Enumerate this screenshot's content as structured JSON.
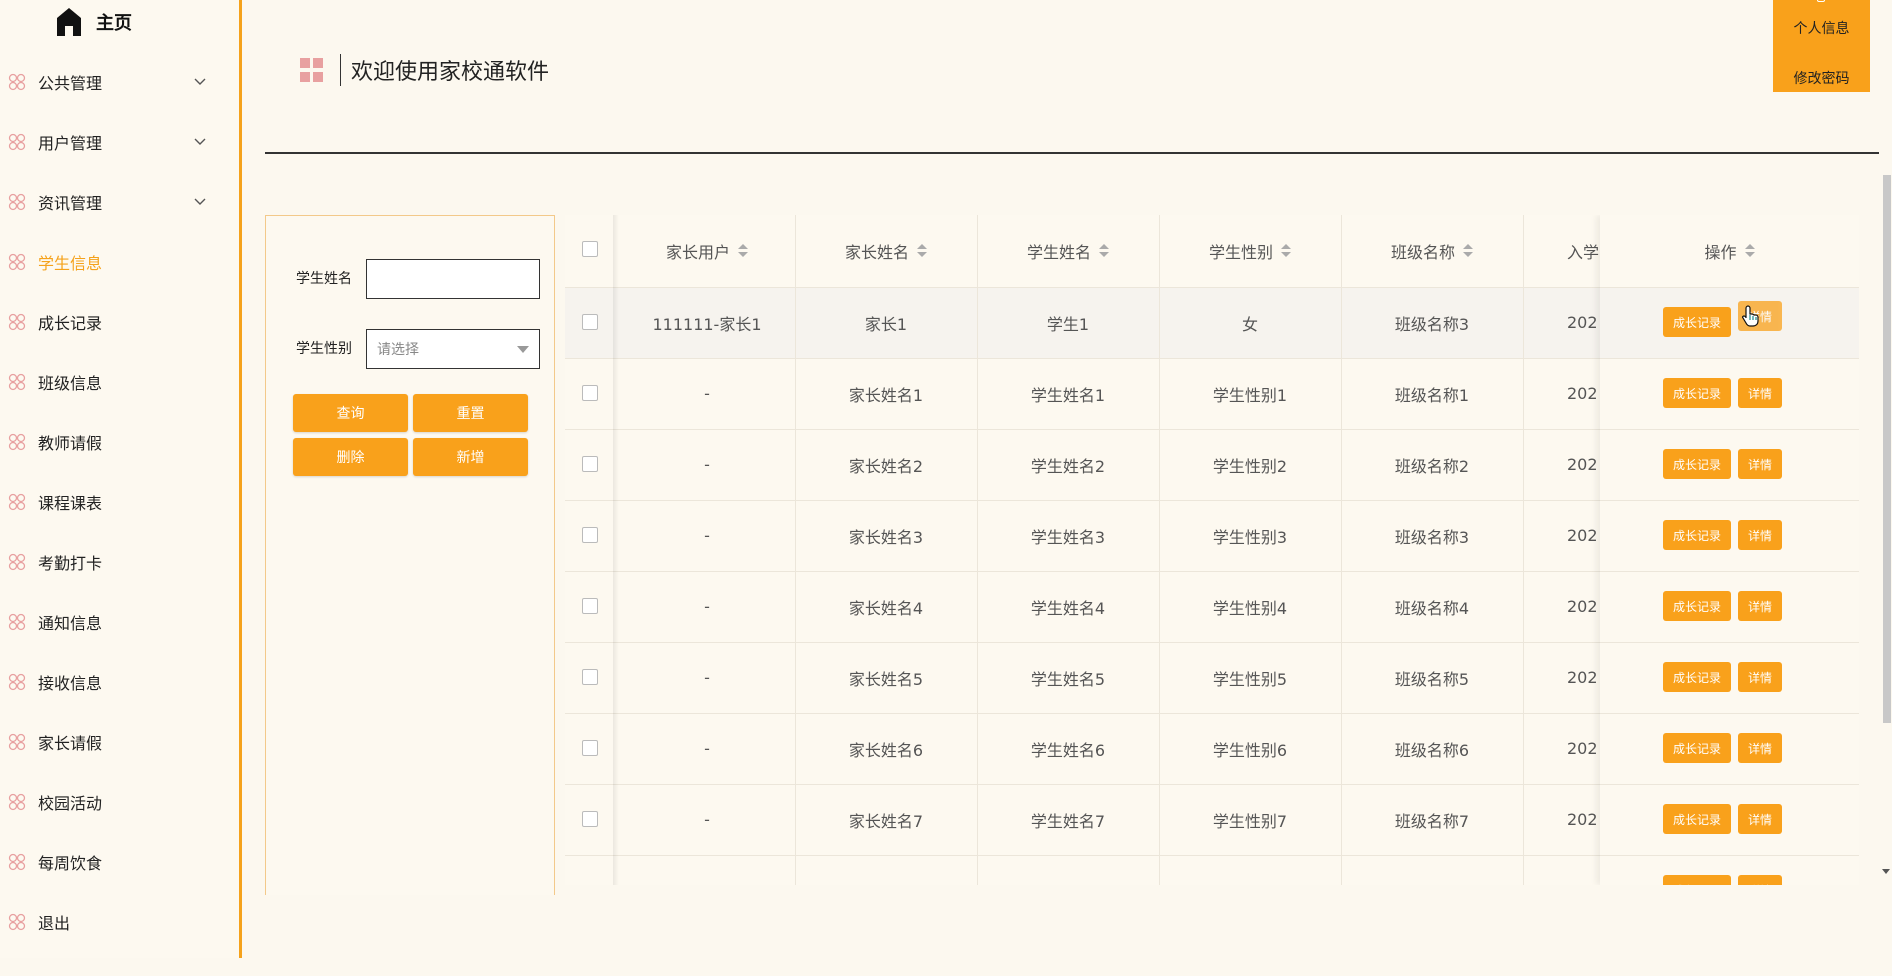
{
  "sidebar": {
    "home_label": "主页",
    "items": [
      {
        "label": "公共管理",
        "has_children": true,
        "active": false
      },
      {
        "label": "用户管理",
        "has_children": true,
        "active": false
      },
      {
        "label": "资讯管理",
        "has_children": true,
        "active": false
      },
      {
        "label": "学生信息",
        "has_children": false,
        "active": true
      },
      {
        "label": "成长记录",
        "has_children": false,
        "active": false
      },
      {
        "label": "班级信息",
        "has_children": false,
        "active": false
      },
      {
        "label": "教师请假",
        "has_children": false,
        "active": false
      },
      {
        "label": "课程课表",
        "has_children": false,
        "active": false
      },
      {
        "label": "考勤打卡",
        "has_children": false,
        "active": false
      },
      {
        "label": "通知信息",
        "has_children": false,
        "active": false
      },
      {
        "label": "接收信息",
        "has_children": false,
        "active": false
      },
      {
        "label": "家长请假",
        "has_children": false,
        "active": false
      },
      {
        "label": "校园活动",
        "has_children": false,
        "active": false
      },
      {
        "label": "每周饮食",
        "has_children": false,
        "active": false
      },
      {
        "label": "退出",
        "has_children": false,
        "active": false
      }
    ]
  },
  "user_menu": {
    "profile_label": "个人信息",
    "password_label": "修改密码"
  },
  "header": {
    "title": "欢迎使用家校通软件"
  },
  "search": {
    "name_label": "学生姓名",
    "name_value": "",
    "gender_label": "学生性别",
    "gender_placeholder": "请选择",
    "query_label": "查询",
    "reset_label": "重置",
    "delete_label": "删除",
    "add_label": "新增"
  },
  "table": {
    "columns": [
      "家长用户",
      "家长姓名",
      "学生姓名",
      "学生性别",
      "班级名称",
      "入学"
    ],
    "op_header": "操作",
    "rows": [
      {
        "cells": [
          "111111-家长1",
          "家长1",
          "学生1",
          "女",
          "班级名称3",
          "202"
        ]
      },
      {
        "cells": [
          "-",
          "家长姓名1",
          "学生姓名1",
          "学生性别1",
          "班级名称1",
          "202"
        ]
      },
      {
        "cells": [
          "-",
          "家长姓名2",
          "学生姓名2",
          "学生性别2",
          "班级名称2",
          "202"
        ]
      },
      {
        "cells": [
          "-",
          "家长姓名3",
          "学生姓名3",
          "学生性别3",
          "班级名称3",
          "202"
        ]
      },
      {
        "cells": [
          "-",
          "家长姓名4",
          "学生姓名4",
          "学生性别4",
          "班级名称4",
          "202"
        ]
      },
      {
        "cells": [
          "-",
          "家长姓名5",
          "学生姓名5",
          "学生性别5",
          "班级名称5",
          "202"
        ]
      },
      {
        "cells": [
          "-",
          "家长姓名6",
          "学生姓名6",
          "学生性别6",
          "班级名称6",
          "202"
        ]
      },
      {
        "cells": [
          "-",
          "家长姓名7",
          "学生姓名7",
          "学生性别7",
          "班级名称7",
          "202"
        ]
      }
    ],
    "growth_btn_label": "成长记录",
    "detail_btn_label": "详情"
  },
  "colors": {
    "accent": "#f9a11b",
    "background": "#fcf8ef",
    "active_menu": "#f5a21b"
  },
  "icons": {
    "home": "home-icon",
    "menu": "flower-icon",
    "expand": "chevron-down-icon",
    "page": "grid-icon",
    "sort": "sort-icon"
  }
}
